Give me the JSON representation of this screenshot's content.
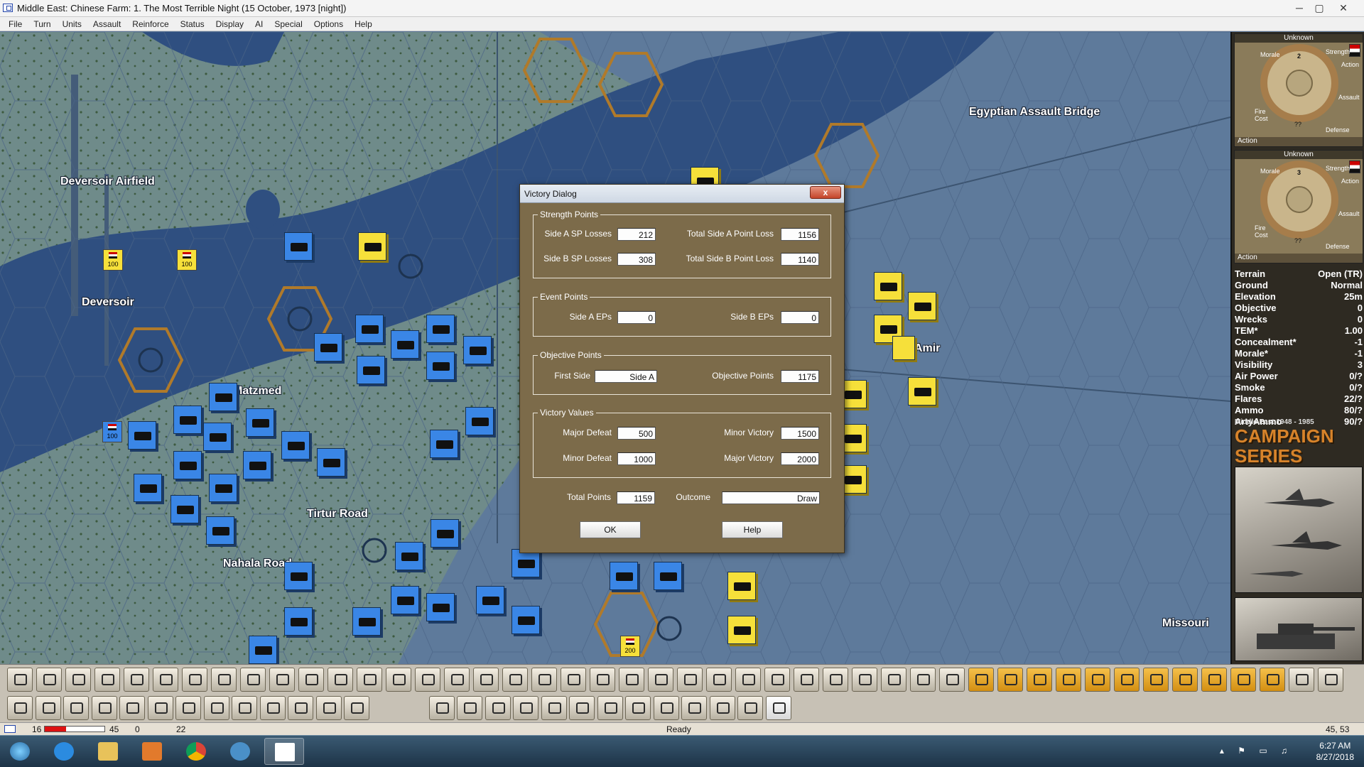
{
  "window": {
    "title": "Middle East: Chinese Farm: 1. The Most Terrible Night (15 October, 1973 [night])",
    "buttons": [
      "─",
      "▢",
      "✕"
    ]
  },
  "menu": [
    "File",
    "Turn",
    "Units",
    "Assault",
    "Reinforce",
    "Status",
    "Display",
    "AI",
    "Special",
    "Options",
    "Help"
  ],
  "map": {
    "labels": [
      "Deversoir Airfield",
      "Deversoir",
      "Matzmed",
      "Tirtur Road",
      "Nahala Road",
      "Egyptian Assault Bridge",
      "Amir",
      "Missouri"
    ],
    "markers": [
      "100",
      "100",
      "100",
      "200"
    ]
  },
  "dialog": {
    "title": "Victory Dialog",
    "close": "x",
    "strength": {
      "legend": "Strength Points",
      "a_losses_label": "Side A SP Losses",
      "a_losses": "212",
      "b_losses_label": "Side B SP Losses",
      "b_losses": "308",
      "a_total_label": "Total Side A Point Loss",
      "a_total": "1156",
      "b_total_label": "Total Side B Point Loss",
      "b_total": "1140"
    },
    "event": {
      "legend": "Event Points",
      "a_label": "Side A EPs",
      "a_value": "0",
      "b_label": "Side B EPs",
      "b_value": "0"
    },
    "objective": {
      "legend": "Objective Points",
      "first_label": "First Side",
      "first_value": "Side A",
      "points_label": "Objective Points",
      "points_value": "1175"
    },
    "victory": {
      "legend": "Victory Values",
      "major_defeat_label": "Major Defeat",
      "major_defeat": "500",
      "minor_defeat_label": "Minor Defeat",
      "minor_defeat": "1000",
      "minor_victory_label": "Minor Victory",
      "minor_victory": "1500",
      "major_victory_label": "Major Victory",
      "major_victory": "2000"
    },
    "total_label": "Total Points",
    "total_value": "1159",
    "outcome_label": "Outcome",
    "outcome_value": "Draw",
    "ok": "OK",
    "help": "Help"
  },
  "right_panel": {
    "cards": [
      {
        "header": "Unknown",
        "strength_value": "2",
        "labels": {
          "morale": "Morale",
          "strength": "Strength",
          "action": "Action",
          "assault": "Assault",
          "fire": "Fire",
          "cost": "Cost",
          "defense": "Defense"
        },
        "unknown": "??",
        "footer": "Action"
      },
      {
        "header": "Unknown",
        "strength_value": "3",
        "labels": {
          "morale": "Morale",
          "strength": "Strength",
          "action": "Action",
          "assault": "Assault",
          "fire": "Fire",
          "cost": "Cost",
          "defense": "Defense"
        },
        "unknown": "??",
        "footer": "Action"
      }
    ],
    "terrain": [
      {
        "label": "Terrain",
        "value": "Open (TR)"
      },
      {
        "label": "Ground",
        "value": "Normal"
      },
      {
        "label": "Elevation",
        "value": "25m"
      },
      {
        "label": "Objective",
        "value": "0"
      },
      {
        "label": "Wrecks",
        "value": "0"
      },
      {
        "label": "TEM*",
        "value": "1.00"
      },
      {
        "label": "Concealment*",
        "value": "-1"
      },
      {
        "label": "Morale*",
        "value": "-1"
      },
      {
        "label": "Visibility",
        "value": "3"
      },
      {
        "label": "Air Power",
        "value": "0/?"
      },
      {
        "label": "Smoke",
        "value": "0/?"
      },
      {
        "label": "Flares",
        "value": "22/?"
      },
      {
        "label": "Ammo",
        "value": "80/?"
      },
      {
        "label": "ArtyAmmo",
        "value": "90/?"
      }
    ],
    "logo_small": "Middle East 1948 - 1985",
    "logo": "CAMPAIGN SERIES"
  },
  "status": {
    "left": "16",
    "bar_value": "45",
    "left2": "0",
    "left3": "22",
    "center": "Ready",
    "right": "45, 53"
  },
  "taskbar": {
    "time": "6:27 AM",
    "date": "8/27/2018"
  },
  "colors": {
    "israeli_unit": "#3a86e6",
    "egyptian_unit": "#f6e03a",
    "dialog_bg": "#7c6b4a",
    "map_water": "#2f4f80"
  }
}
